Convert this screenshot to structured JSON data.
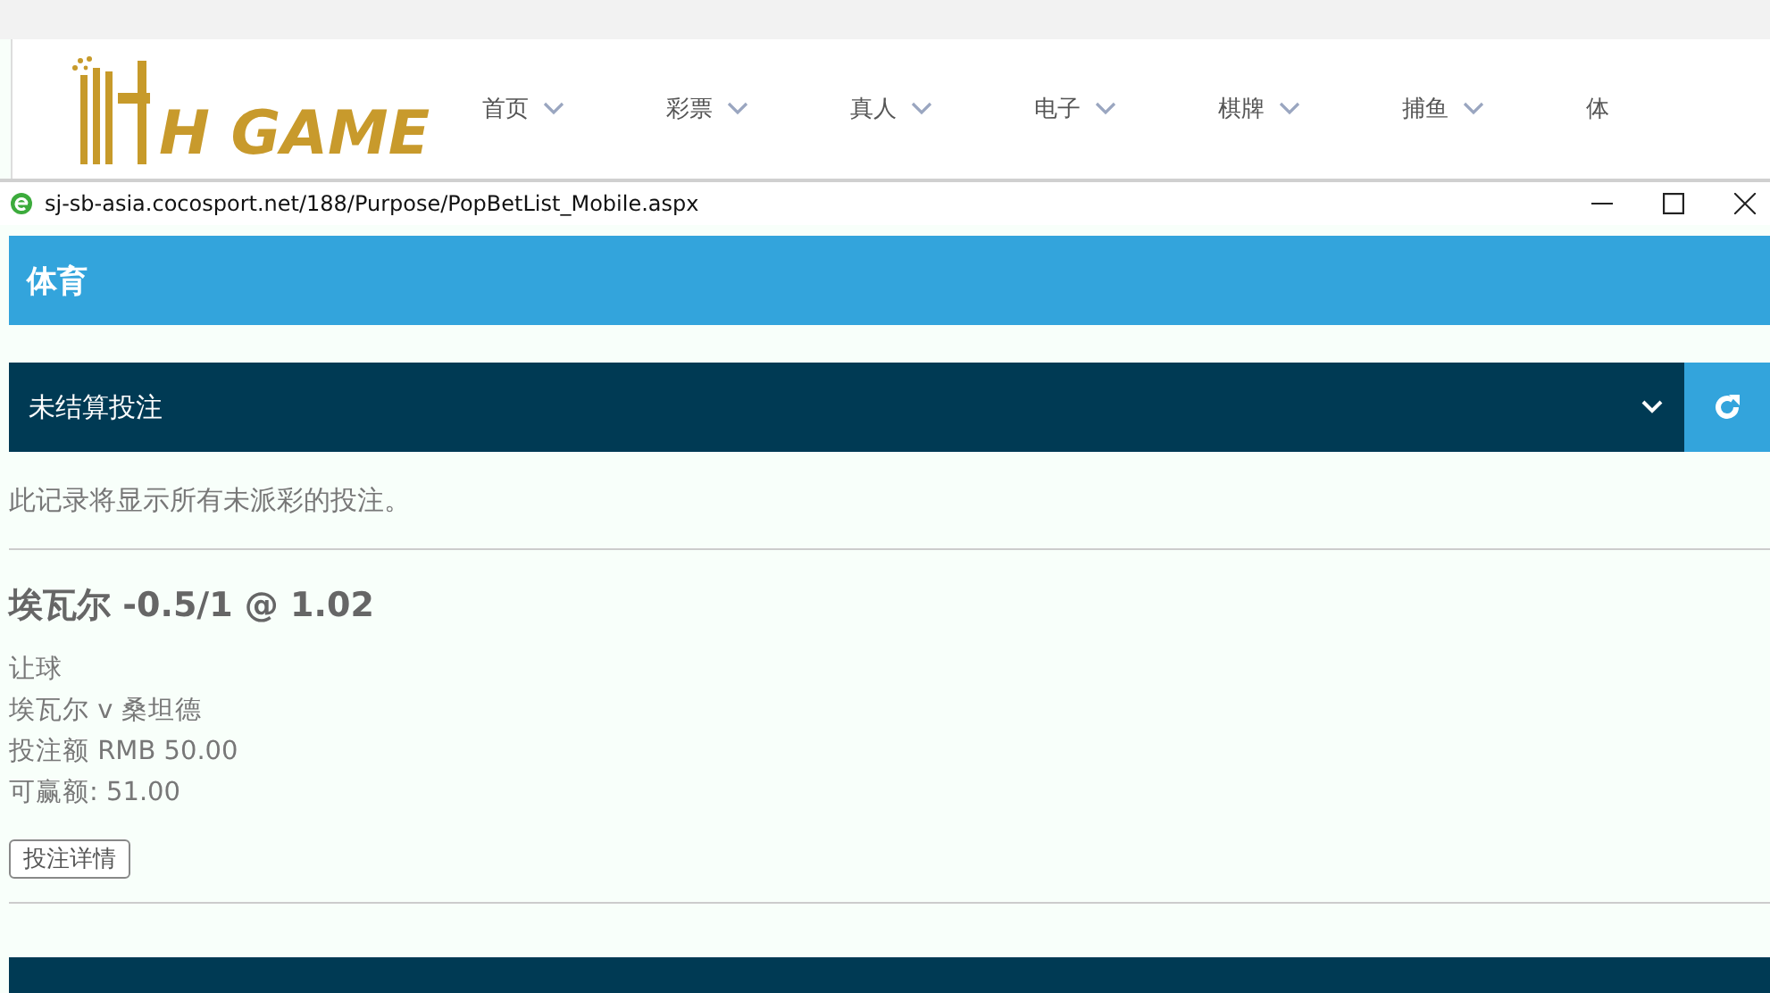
{
  "site_header": {
    "logo": "H GAME",
    "nav": [
      {
        "label": "首页",
        "dropdown": true
      },
      {
        "label": "彩票",
        "dropdown": true
      },
      {
        "label": "真人",
        "dropdown": true
      },
      {
        "label": "电子",
        "dropdown": true
      },
      {
        "label": "棋牌",
        "dropdown": true
      },
      {
        "label": "捕鱼",
        "dropdown": true
      },
      {
        "label": "体",
        "dropdown": false
      }
    ]
  },
  "popup": {
    "url": "sj-sb-asia.cocosport.net/188/Purpose/PopBetList_Mobile.aspx"
  },
  "page_title": "体育",
  "filter": {
    "value": "未结算投注"
  },
  "description": "此记录将显示所有未派彩的投注。",
  "bets": [
    {
      "title": "埃瓦尔 -0.5/1 @ 1.02",
      "lines": [
        "让球",
        "埃瓦尔 v 桑坦德",
        "投注额 RMB 50.00",
        "可赢额: 51.00"
      ],
      "button": "投注详情"
    }
  ]
}
